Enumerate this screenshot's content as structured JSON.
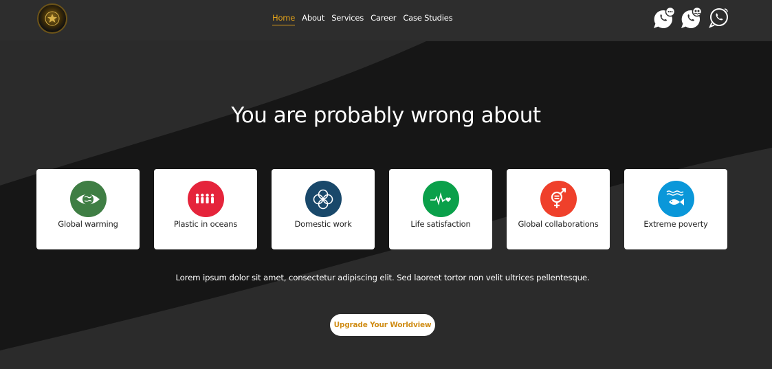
{
  "header": {
    "logo_name": "emblem-logo",
    "nav": [
      {
        "label": "Home",
        "active": true
      },
      {
        "label": "About",
        "active": false
      },
      {
        "label": "Services",
        "active": false
      },
      {
        "label": "Career",
        "active": false
      },
      {
        "label": "Case Studies",
        "active": false
      }
    ],
    "contact_icons": [
      "whatsapp-chat-icon",
      "whatsapp-group-icon",
      "whatsapp-call-icon"
    ]
  },
  "hero": {
    "title": "You are probably wrong about",
    "cards": [
      {
        "label": "Global warming",
        "icon": "eye-globe-icon",
        "color": "#3f7e44"
      },
      {
        "label": "Plastic in oceans",
        "icon": "people-icon",
        "color": "#e5243b"
      },
      {
        "label": "Domestic work",
        "icon": "flower-rings-icon",
        "color": "#19486a"
      },
      {
        "label": "Life satisfaction",
        "icon": "heartbeat-icon",
        "color": "#0aa04a"
      },
      {
        "label": "Global collaborations",
        "icon": "gender-equality-icon",
        "color": "#ef402b"
      },
      {
        "label": "Extreme poverty",
        "icon": "fish-waves-icon",
        "color": "#0a97d9"
      }
    ],
    "description": "Lorem ipsum dolor sit amet, consectetur adipiscing elit. Sed laoreet tortor non velit ultrices pellentesque.",
    "cta_label": "Upgrade Your Worldview"
  },
  "colors": {
    "accent": "#e3a21a",
    "cta_text": "#d08d16",
    "header_bg": "#2d2d2d",
    "hero_dark": "#161616",
    "hero_mid": "#2b2b2b"
  }
}
